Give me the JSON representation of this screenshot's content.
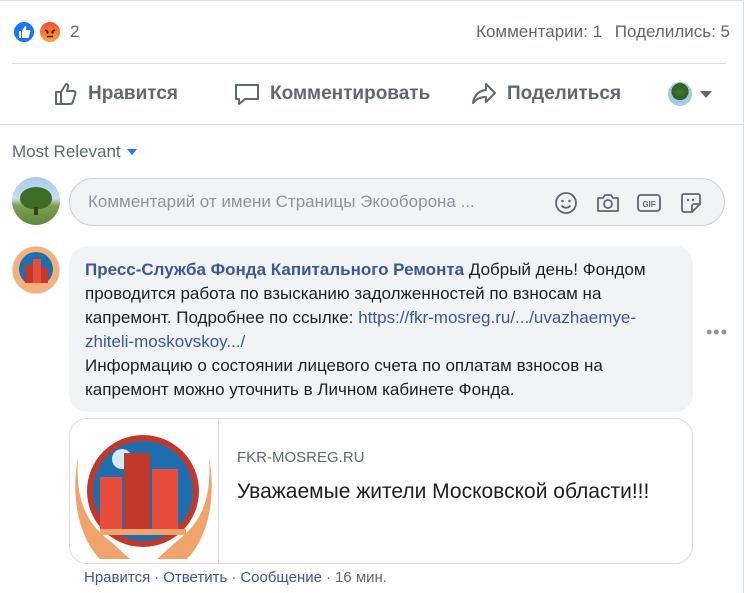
{
  "post": {
    "reaction_count": "2",
    "comments_count": "Комментарии: 1",
    "shares_count": "Поделились: 5"
  },
  "actions": {
    "like": "Нравится",
    "comment": "Комментировать",
    "share": "Поделиться"
  },
  "filter": {
    "label": "Most Relevant"
  },
  "composer": {
    "placeholder": "Комментарий от имени Страницы Экооборона ..."
  },
  "comment": {
    "author": "Пресс-Служба Фонда Капитального Ремонта",
    "text_1": "Добрый день! Фондом проводится работа по взысканию задолженностей по взносам на капремонт. Подробнее по ссылке:",
    "link": "https://fkr-mosreg.ru/.../uvazhaemye-zhiteli-moskovskoy.../",
    "text_2": "Информацию о состоянии лицевого счета по оплатам взносов на капремонт можно уточнить в Личном кабинете Фонда.",
    "more": "•••",
    "preview": {
      "domain": "FKR-MOSREG.RU",
      "title": "Уважаемые жители Московской области!!!"
    },
    "meta": {
      "like": "Нравится",
      "reply": "Ответить",
      "message": "Сообщение",
      "time": "16 мин.",
      "separator": "·"
    }
  },
  "colors": {
    "link": "#385898",
    "accent": "#1877f2",
    "muted": "#606770",
    "bubble": "#f2f3f5"
  },
  "icons": [
    "like-reaction-icon",
    "angry-reaction-icon",
    "thumbs-up-icon",
    "speech-bubble-icon",
    "share-arrow-icon",
    "chevron-down-icon",
    "emoji-icon",
    "camera-icon",
    "gif-icon",
    "sticker-icon",
    "more-options-icon"
  ]
}
